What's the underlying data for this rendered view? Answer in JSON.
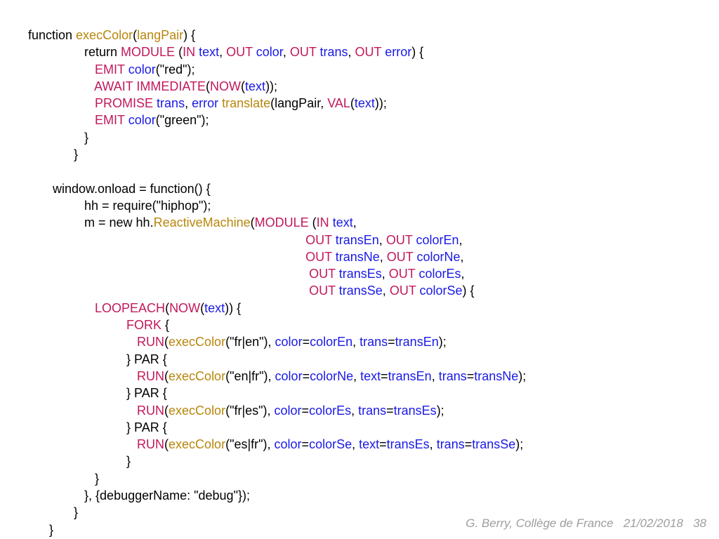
{
  "code": {
    "l1": {
      "a": "function ",
      "b": "execColor",
      "c": "(",
      "d": "langPair",
      "e": ") {"
    },
    "l2": {
      "a": "                return ",
      "b": "MODULE ",
      "c": "(",
      "d": "IN ",
      "e": "text",
      "f": ", ",
      "g": "OUT ",
      "h": "color",
      "i": ", ",
      "j": "OUT ",
      "k": "trans",
      "l": ", ",
      "m": "OUT ",
      "n": "error",
      "o": ") {"
    },
    "l3": {
      "a": "                   ",
      "b": "EMIT ",
      "c": "color",
      "d": "(\"red\");"
    },
    "l4": {
      "a": "                   ",
      "b": "AWAIT IMMEDIATE",
      "c": "(",
      "d": "NOW",
      "e": "(",
      "f": "text",
      "g": "));"
    },
    "l5": {
      "a": "                   ",
      "b": "PROMISE ",
      "c": "trans",
      "d": ", ",
      "e": "error ",
      "f": "translate",
      "g": "(langPair, ",
      "h": "VAL",
      "i": "(",
      "j": "text",
      "k": "));"
    },
    "l6": {
      "a": "                   ",
      "b": "EMIT ",
      "c": "color",
      "d": "(\"green\");"
    },
    "l7": "                }",
    "l8": "             }",
    "l9": "",
    "l10": "       window.onload = function() {",
    "l11": "                hh = require(\"hiphop\");",
    "l12": {
      "a": "                m = new hh.",
      "b": "ReactiveMachine",
      "c": "(",
      "d": "MODULE ",
      "e": "(",
      "f": "IN ",
      "g": "text",
      "h": ","
    },
    "l13": {
      "a": "                                                                               ",
      "b": "OUT ",
      "c": "transEn",
      "d": ", ",
      "e": "OUT ",
      "f": "colorEn",
      "g": ","
    },
    "l14": {
      "a": "                                                                               ",
      "b": "OUT ",
      "c": "transNe",
      "d": ", ",
      "e": "OUT ",
      "f": "colorNe",
      "g": ","
    },
    "l15": {
      "a": "                                                                                ",
      "b": "OUT ",
      "c": "transEs",
      "d": ", ",
      "e": "OUT ",
      "f": "colorEs",
      "g": ","
    },
    "l16": {
      "a": "                                                                                ",
      "b": "OUT ",
      "c": "transSe",
      "d": ", ",
      "e": "OUT ",
      "f": "colorSe",
      "g": ") {"
    },
    "l17": {
      "a": "                   ",
      "b": "LOOPEACH",
      "c": "(",
      "d": "NOW",
      "e": "(",
      "f": "text",
      "g": ")) {"
    },
    "l18": {
      "a": "                            ",
      "b": "FORK ",
      "c": "{"
    },
    "l19": {
      "a": "                               ",
      "b": "RUN",
      "c": "(",
      "d": "execColor",
      "e": "(\"fr|en\"), ",
      "f": "color",
      "g": "=",
      "h": "colorEn",
      "i": ", ",
      "j": "trans",
      "k": "=",
      "l": "transEn",
      "m": ");"
    },
    "l20": {
      "a": "                            } ",
      "b": "PAR {"
    },
    "l21": {
      "a": "                               ",
      "b": "RUN",
      "c": "(",
      "d": "execColor",
      "e": "(\"en|fr\"), ",
      "f": "color",
      "g": "=",
      "h": "colorNe",
      "i": ", ",
      "j": "text",
      "k": "=",
      "l": "transEn",
      "m": ", ",
      "n": "trans",
      "o": "=",
      "p": "transNe",
      "q": ");"
    },
    "l22": {
      "a": "                            } ",
      "b": "PAR {"
    },
    "l23": {
      "a": "                               ",
      "b": "RUN",
      "c": "(",
      "d": "execColor",
      "e": "(\"fr|es\"), ",
      "f": "color",
      "g": "=",
      "h": "colorEs",
      "i": ", ",
      "j": "trans",
      "k": "=",
      "l": "transEs",
      "m": ");"
    },
    "l24": {
      "a": "                            } ",
      "b": "PAR {"
    },
    "l25": {
      "a": "                               ",
      "b": "RUN",
      "c": "(",
      "d": "execColor",
      "e": "(\"es|fr\"), ",
      "f": "color",
      "g": "=",
      "h": "colorSe",
      "i": ", ",
      "j": "text",
      "k": "=",
      "l": "transEs",
      "m": ", ",
      "n": "trans",
      "o": "=",
      "p": "transSe",
      "q": ");"
    },
    "l26": "                            }",
    "l27": "                   }",
    "l28": "                }, {debuggerName: \"debug\"});",
    "l29": "             }",
    "l30": "      }"
  },
  "footer": {
    "author": "G. Berry, Collège de France",
    "date": "21/02/2018",
    "page": "38"
  }
}
